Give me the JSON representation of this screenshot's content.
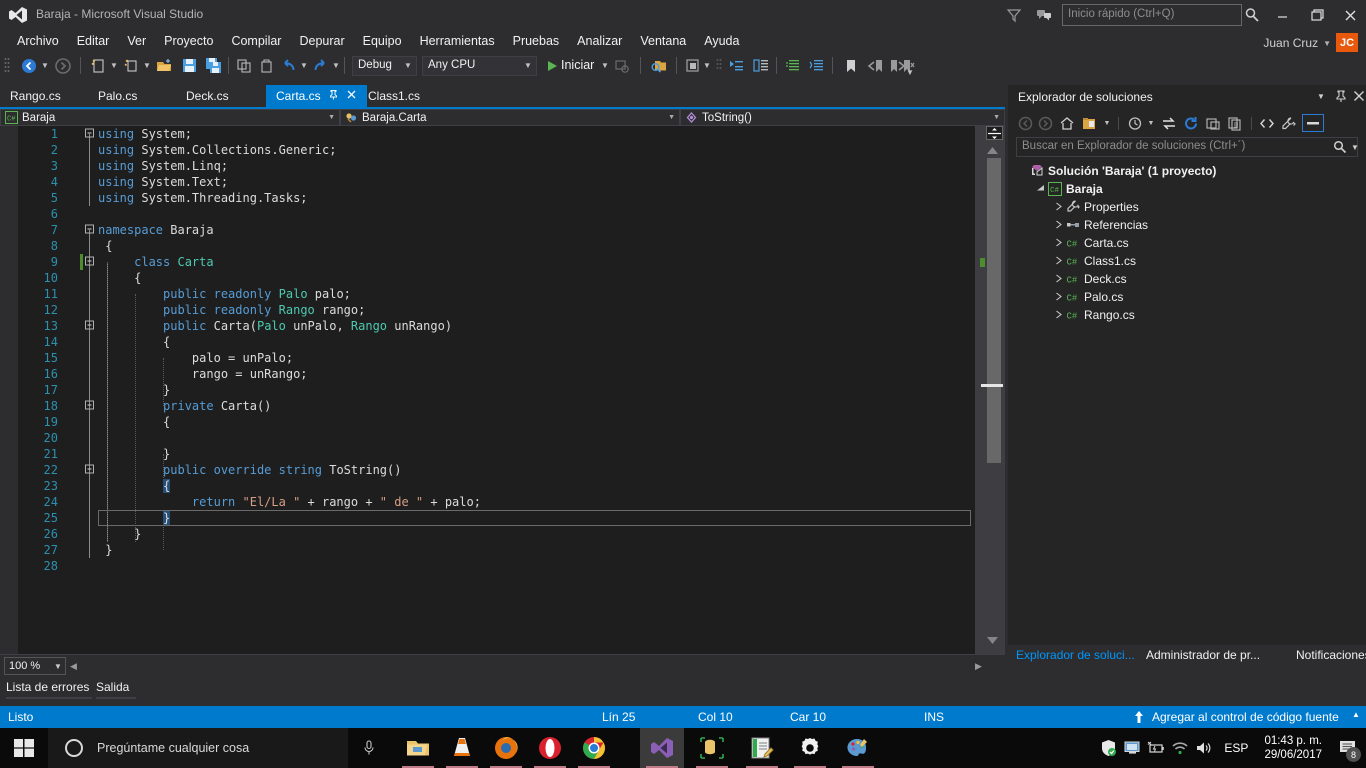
{
  "window": {
    "title": "Baraja - Microsoft Visual Studio",
    "logo_icon": "visual-studio-logo",
    "minimize_icon": "minimize-icon",
    "maximize_icon": "restore-icon",
    "close_icon": "close-icon",
    "filter_icon": "filter-icon",
    "feedback_icon": "feedback-icon"
  },
  "quick_launch": {
    "placeholder": "Inicio rápido (Ctrl+Q)",
    "value": "",
    "icon": "search-icon"
  },
  "user": {
    "name": "Juan Cruz",
    "initials": "JC",
    "accent": "#e8590c"
  },
  "menu": {
    "items": [
      "Archivo",
      "Editar",
      "Ver",
      "Proyecto",
      "Compilar",
      "Depurar",
      "Equipo",
      "Herramientas",
      "Pruebas",
      "Analizar",
      "Ventana",
      "Ayuda"
    ]
  },
  "toolbar": {
    "nav_back_icon": "navigate-back-icon",
    "nav_forward_icon": "navigate-forward-icon",
    "new_project_icon": "new-project-icon",
    "new_item_icon": "new-item-icon",
    "open_file_icon": "open-file-icon",
    "save_icon": "save-icon",
    "save_all_icon": "save-all-icon",
    "cut_icon": "cut-icon",
    "copy_icon": "copy-icon",
    "undo_icon": "undo-icon",
    "redo_icon": "redo-icon",
    "config_value": "Debug",
    "platform_value": "Any CPU",
    "start_label": "Iniciar",
    "start_icon": "play-icon",
    "attach_icon": "attach-process-icon",
    "find_icon": "find-in-files-icon",
    "solution_icon": "solution-platform-icon",
    "step_into_icon": "step-into-icon",
    "step_over_icon": "step-over-icon",
    "comment_icon": "comment-icon",
    "uncomment_icon": "uncomment-icon",
    "bookmark_icon": "bookmark-icon",
    "prev_bookmark_icon": "previous-bookmark-icon",
    "next_bookmark_icon": "next-bookmark-icon",
    "clear_bookmark_icon": "clear-bookmarks-icon"
  },
  "tabs": [
    {
      "label": "Rango.cs",
      "active": false
    },
    {
      "label": "Palo.cs",
      "active": false
    },
    {
      "label": "Deck.cs",
      "active": false
    },
    {
      "label": "Carta.cs",
      "active": true,
      "pin_icon": "pin-icon",
      "close_icon": "close-icon"
    },
    {
      "label": "Class1.cs",
      "active": false
    }
  ],
  "navbar": {
    "project": "Baraja",
    "project_icon": "csharp-project-icon",
    "type": "Baraja.Carta",
    "type_icon": "class-icon",
    "member": "ToString()",
    "member_icon": "method-icon"
  },
  "editor": {
    "zoom": "100 %",
    "lines": [
      {
        "n": "1",
        "fold": "minus",
        "tokens": [
          {
            "t": "using ",
            "c": "k"
          },
          {
            "t": "System;",
            "c": "p"
          }
        ]
      },
      {
        "n": "2",
        "fold": "",
        "tokens": [
          {
            "t": "using ",
            "c": "k"
          },
          {
            "t": "System.Collections.Generic;",
            "c": "p"
          }
        ]
      },
      {
        "n": "3",
        "fold": "",
        "tokens": [
          {
            "t": "using ",
            "c": "k"
          },
          {
            "t": "System.Linq;",
            "c": "p"
          }
        ]
      },
      {
        "n": "4",
        "fold": "",
        "tokens": [
          {
            "t": "using ",
            "c": "k"
          },
          {
            "t": "System.Text;",
            "c": "p"
          }
        ]
      },
      {
        "n": "5",
        "fold": "",
        "tokens": [
          {
            "t": "using ",
            "c": "k"
          },
          {
            "t": "System.Threading.Tasks;",
            "c": "p"
          }
        ]
      },
      {
        "n": "6",
        "fold": "",
        "tokens": []
      },
      {
        "n": "7",
        "fold": "minus",
        "tokens": [
          {
            "t": "namespace ",
            "c": "k"
          },
          {
            "t": "Baraja",
            "c": "p"
          }
        ]
      },
      {
        "n": "8",
        "fold": "",
        "tokens": [
          {
            "t": " {",
            "c": "p"
          }
        ]
      },
      {
        "n": "9",
        "fold": "minus",
        "change": true,
        "tokens": [
          {
            "t": "     ",
            "c": "p"
          },
          {
            "t": "class ",
            "c": "k"
          },
          {
            "t": "Carta",
            "c": "t"
          }
        ]
      },
      {
        "n": "10",
        "fold": "",
        "tokens": [
          {
            "t": "     {",
            "c": "p"
          }
        ]
      },
      {
        "n": "11",
        "fold": "",
        "tokens": [
          {
            "t": "         ",
            "c": "p"
          },
          {
            "t": "public ",
            "c": "k"
          },
          {
            "t": "readonly ",
            "c": "k"
          },
          {
            "t": "Palo",
            "c": "t"
          },
          {
            "t": " palo;",
            "c": "p"
          }
        ]
      },
      {
        "n": "12",
        "fold": "",
        "tokens": [
          {
            "t": "         ",
            "c": "p"
          },
          {
            "t": "public ",
            "c": "k"
          },
          {
            "t": "readonly ",
            "c": "k"
          },
          {
            "t": "Rango",
            "c": "t"
          },
          {
            "t": " rango;",
            "c": "p"
          }
        ]
      },
      {
        "n": "13",
        "fold": "minus",
        "tokens": [
          {
            "t": "         ",
            "c": "p"
          },
          {
            "t": "public ",
            "c": "k"
          },
          {
            "t": "Carta(",
            "c": "p"
          },
          {
            "t": "Palo",
            "c": "t"
          },
          {
            "t": " unPalo, ",
            "c": "p"
          },
          {
            "t": "Rango",
            "c": "t"
          },
          {
            "t": " unRango)",
            "c": "p"
          }
        ]
      },
      {
        "n": "14",
        "fold": "",
        "tokens": [
          {
            "t": "         {",
            "c": "p"
          }
        ]
      },
      {
        "n": "15",
        "fold": "",
        "tokens": [
          {
            "t": "             palo = unPalo;",
            "c": "p"
          }
        ]
      },
      {
        "n": "16",
        "fold": "",
        "tokens": [
          {
            "t": "             rango = unRango;",
            "c": "p"
          }
        ]
      },
      {
        "n": "17",
        "fold": "",
        "tokens": [
          {
            "t": "         }",
            "c": "p"
          }
        ]
      },
      {
        "n": "18",
        "fold": "minus",
        "tokens": [
          {
            "t": "         ",
            "c": "p"
          },
          {
            "t": "private ",
            "c": "k"
          },
          {
            "t": "Carta()",
            "c": "p"
          }
        ]
      },
      {
        "n": "19",
        "fold": "",
        "tokens": [
          {
            "t": "         {",
            "c": "p"
          }
        ]
      },
      {
        "n": "20",
        "fold": "",
        "tokens": []
      },
      {
        "n": "21",
        "fold": "",
        "tokens": [
          {
            "t": "         }",
            "c": "p"
          }
        ]
      },
      {
        "n": "22",
        "fold": "minus",
        "tokens": [
          {
            "t": "         ",
            "c": "p"
          },
          {
            "t": "public ",
            "c": "k"
          },
          {
            "t": "override ",
            "c": "k"
          },
          {
            "t": "string ",
            "c": "k"
          },
          {
            "t": "ToString()",
            "c": "p"
          }
        ]
      },
      {
        "n": "23",
        "fold": "",
        "tokens": [
          {
            "t": "         ",
            "c": "p"
          },
          {
            "t": "{",
            "c": "brace-hl"
          }
        ]
      },
      {
        "n": "24",
        "fold": "",
        "tokens": [
          {
            "t": "             ",
            "c": "p"
          },
          {
            "t": "return ",
            "c": "k"
          },
          {
            "t": "\"El/La \"",
            "c": "s"
          },
          {
            "t": " + rango + ",
            "c": "p"
          },
          {
            "t": "\" de \"",
            "c": "s"
          },
          {
            "t": " + palo;",
            "c": "p"
          }
        ]
      },
      {
        "n": "25",
        "fold": "",
        "current": true,
        "tokens": [
          {
            "t": "         ",
            "c": "p"
          },
          {
            "t": "}",
            "c": "brace-hl"
          }
        ]
      },
      {
        "n": "26",
        "fold": "",
        "tokens": [
          {
            "t": "     }",
            "c": "p"
          }
        ]
      },
      {
        "n": "27",
        "fold": "",
        "tokens": [
          {
            "t": " }",
            "c": "p"
          }
        ]
      },
      {
        "n": "28",
        "fold": "",
        "tokens": []
      }
    ]
  },
  "panel_tabs": [
    {
      "label": "Lista de errores"
    },
    {
      "label": "Salida"
    }
  ],
  "solution_explorer": {
    "title": "Explorador de soluciones",
    "dropdown_icon": "chevron-down-icon",
    "pin_icon": "pin-icon",
    "close_icon": "close-icon",
    "search_placeholder": "Buscar en Explorador de soluciones (Ctrl+´)",
    "search_value": "",
    "toolbar_icons": [
      "back-icon",
      "forward-icon",
      "home-icon",
      "pending-changes-icon",
      "sync-icon",
      "refresh-icon",
      "collapse-all-icon",
      "show-all-files-icon",
      "preview-selected-items-icon",
      "view-code-icon",
      "properties-icon",
      "property-pages-icon"
    ],
    "tree": [
      {
        "indent": 0,
        "arrow": "",
        "icon": "solution-icon",
        "label": "Solución 'Baraja'  (1 proyecto)",
        "bold": true
      },
      {
        "indent": 1,
        "arrow": "▲",
        "icon": "csharp-project-icon",
        "label": "Baraja",
        "bold": true
      },
      {
        "indent": 2,
        "arrow": "▷",
        "icon": "wrench-icon",
        "label": "Properties"
      },
      {
        "indent": 2,
        "arrow": "▷",
        "icon": "references-icon",
        "label": "Referencias"
      },
      {
        "indent": 2,
        "arrow": "▷",
        "icon": "csharp-file-icon",
        "label": "Carta.cs"
      },
      {
        "indent": 2,
        "arrow": "▷",
        "icon": "csharp-file-icon",
        "label": "Class1.cs"
      },
      {
        "indent": 2,
        "arrow": "▷",
        "icon": "csharp-file-icon",
        "label": "Deck.cs"
      },
      {
        "indent": 2,
        "arrow": "▷",
        "icon": "csharp-file-icon",
        "label": "Palo.cs"
      },
      {
        "indent": 2,
        "arrow": "▷",
        "icon": "csharp-file-icon",
        "label": "Rango.cs"
      }
    ],
    "footer_tabs": [
      {
        "label": "Explorador de soluci...",
        "active": true
      },
      {
        "label": "Administrador de pr...",
        "active": false
      },
      {
        "label": "Notificaciones",
        "active": false
      }
    ]
  },
  "statusbar": {
    "status": "Listo",
    "line": "Lín 25",
    "col": "Col 10",
    "char": "Car 10",
    "insert": "INS",
    "source_control": "Agregar al control de código fuente",
    "upload_icon": "upload-arrow-icon",
    "expand_icon": "chevron-up-icon",
    "accent": "#007acc"
  },
  "taskbar": {
    "start_icon": "windows-start-icon",
    "cortana_placeholder": "Pregúntame cualquier cosa",
    "cortana_circle_icon": "cortana-circle-icon",
    "mic_icon": "microphone-icon",
    "apps": [
      {
        "name": "file-explorer-icon",
        "open": true
      },
      {
        "name": "vlc-media-player-icon",
        "open": true
      },
      {
        "name": "firefox-icon",
        "open": true
      },
      {
        "name": "opera-icon",
        "open": true
      },
      {
        "name": "chrome-icon",
        "open": true
      },
      {
        "name": "visual-studio-icon",
        "open": true,
        "active": true
      },
      {
        "name": "sql-server-tools-icon",
        "open": true
      },
      {
        "name": "notepad-icon",
        "open": true
      },
      {
        "name": "settings-icon",
        "open": true
      },
      {
        "name": "paint-icon",
        "open": true
      }
    ],
    "tray": {
      "icons": [
        "windows-defender-icon",
        "remote-desktop-icon",
        "battery-icon",
        "wifi-icon",
        "volume-icon"
      ],
      "language": "ESP",
      "time": "01:43 p. m.",
      "date": "29/06/2017",
      "notification_icon": "action-center-icon",
      "notification_count": "8"
    }
  }
}
